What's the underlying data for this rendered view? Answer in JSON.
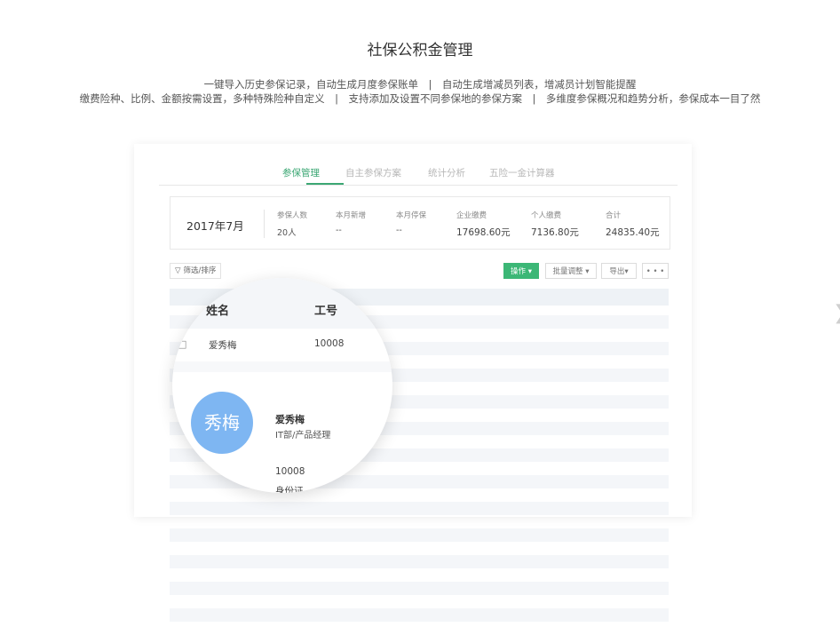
{
  "hero": {
    "title": "社保公积金管理",
    "line1": "一键导入历史参保记录，自动生成月度参保账单　|　自动生成增减员列表，增减员计划智能提醒",
    "line2": "缴费险种、比例、金额按需设置，多种特殊险种自定义　|　支持添加及设置不同参保地的参保方案　|　多维度参保概况和趋势分析，参保成本一目了然"
  },
  "tabs": [
    "参保管理",
    "自主参保方案",
    "统计分析",
    "五险一金计算器"
  ],
  "active_tab": 0,
  "summary": {
    "month": "2017年7月",
    "stats": [
      {
        "label": "参保人数",
        "value": "20人"
      },
      {
        "label": "本月新增",
        "value": "--"
      },
      {
        "label": "本月停保",
        "value": "--"
      },
      {
        "label": "企业缴费",
        "value": "17698.60元"
      },
      {
        "label": "个人缴费",
        "value": "7136.80元"
      },
      {
        "label": "合计",
        "value": "24835.40元"
      }
    ]
  },
  "toolbar": {
    "filter": "筛选/排序",
    "operate": "操作 ▾",
    "batch": "批量调整 ▾",
    "export": "导出▾",
    "more": "• • •"
  },
  "table": {
    "columns": [
      "姓名",
      "工号"
    ],
    "row": {
      "name": "爱秀梅",
      "no": "10008"
    }
  },
  "profile": {
    "avatar_text": "秀梅",
    "name": "爱秀梅",
    "dept": "IT部/产品经理",
    "no": "10008",
    "id_label": "身份证"
  },
  "icons": {
    "filter": "filter-icon",
    "checkbox": "checkbox-icon",
    "next": "chevron-right-icon"
  },
  "colors": {
    "accent": "#3ca774",
    "primary_button": "#3cb776",
    "avatar": "#7eb6f2"
  }
}
